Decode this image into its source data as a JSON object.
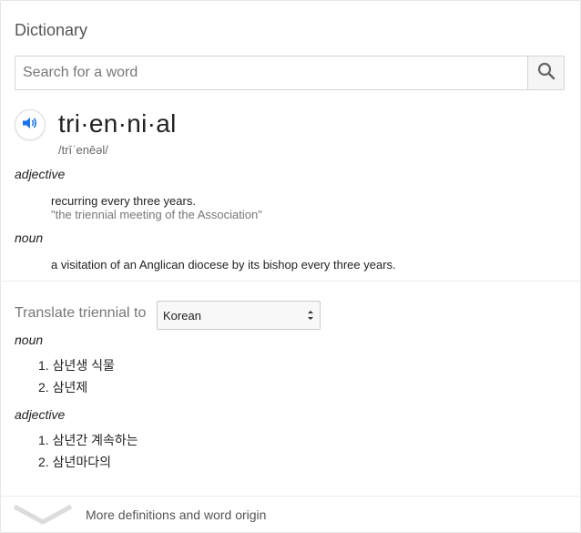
{
  "panel": {
    "title": "Dictionary"
  },
  "search": {
    "placeholder": "Search for a word",
    "value": "",
    "icon": "search-icon"
  },
  "entry": {
    "speaker_icon": "speaker-icon",
    "headword": "tri·en·ni·al",
    "phonetic": "/trīˈenēəl/",
    "senses": [
      {
        "pos": "adjective",
        "definition": "recurring every three years.",
        "example": "\"the triennial meeting of the Association\""
      },
      {
        "pos": "noun",
        "definition": "a visitation of an Anglican diocese by its bishop every three years."
      }
    ]
  },
  "translate": {
    "label": "Translate triennial to",
    "selected_language": "Korean",
    "groups": [
      {
        "pos": "noun",
        "items": [
          "1. 삼년생 식물",
          "2. 삼년제"
        ]
      },
      {
        "pos": "adjective",
        "items": [
          "1. 삼년간 계속하는",
          "2. 삼년마다의"
        ]
      }
    ]
  },
  "footer": {
    "more_label": "More definitions and word origin",
    "icon": "chevron-down-icon"
  },
  "colors": {
    "accent": "#4285f4",
    "text": "#222222",
    "muted": "#777777",
    "border": "#d4d4d4"
  }
}
